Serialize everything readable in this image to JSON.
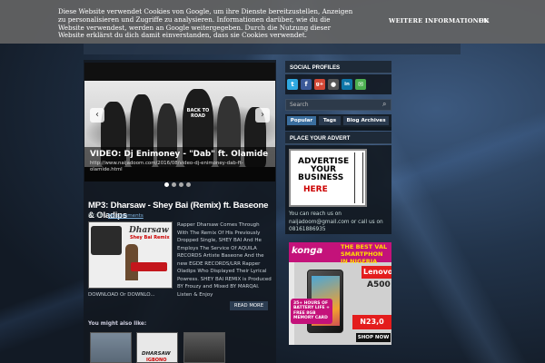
{
  "cookie_bar": {
    "message": "Diese Website verwendet Cookies von Google, um ihre Dienste bereitzustellen, Anzeigen zu personalisieren und Zugriffe zu analysieren. Informationen darüber, wie du die Website verwendest, werden an Google weitergegeben. Durch die Nutzung dieser Website erklärst du dich damit einverstanden, dass sie Cookies verwendet.",
    "more_info_label": "WEITERE INFORMATIONEN",
    "ok_label": "OK"
  },
  "slider": {
    "title": "VIDEO: Dj Enimoney - \"Dab\" ft. Olamide",
    "url": "http://www.naijadoom.com/2016/08/video-dj-enimoney-dab-ft-olamide.html",
    "prev_icon": "chevron-left-icon",
    "next_icon": "chevron-right-icon",
    "shirt_text": "BACK TO ROAD",
    "dots_count": 4,
    "active_dot": 1
  },
  "post": {
    "title": "MP3: Dharsaw - Shey Bai (Remix) ft. Baseone & Oladips",
    "time": "07:18",
    "comments": "No comments",
    "thumb_title": "Dharsaw",
    "thumb_subtitle": "Shey Bai Remix",
    "excerpt": "Rapper Dharsaw Comes Through With The Remix Of His Previously Dropped Single, SHEY BAI And He Employs The Service Of AQUILA RECORDS Artiste Baseone And the new EGDE RECORDS/LRR Rapper Oladips Who Displayed Their Lyrical Powress. SHEY BAI REMIX is Produced BY Frouzy and Mixed BY MARQAI. Listen & Enjoy",
    "excerpt_end": "DOWNLOAD Or DOWNLO...",
    "read_more": "READ MORE"
  },
  "related": {
    "title": "You might also like:",
    "items": [
      {
        "label": ""
      },
      {
        "label": "DHARSAW",
        "sub": "IGBONO"
      },
      {
        "label": ""
      }
    ]
  },
  "sidebar": {
    "social_title": "SOCIAL PROFILES",
    "social_icons": [
      {
        "name": "twitter-icon",
        "glyph": "t",
        "color": "#2fa8e0"
      },
      {
        "name": "facebook-icon",
        "glyph": "f",
        "color": "#3b5998"
      },
      {
        "name": "google-plus-icon",
        "glyph": "g+",
        "color": "#d34836"
      },
      {
        "name": "rss-icon",
        "glyph": "●",
        "color": "#555555"
      },
      {
        "name": "linkedin-icon",
        "glyph": "in",
        "color": "#0e76a8"
      },
      {
        "name": "email-icon",
        "glyph": "✉",
        "color": "#4caf50"
      }
    ],
    "search_placeholder": "Search",
    "tabs": [
      "Popular",
      "Tags",
      "Blog Archives"
    ],
    "active_tab": 0,
    "advert_title": "PLACE YOUR ADVERT",
    "advert_banner_line1": "ADVERTISE",
    "advert_banner_line2": "YOUR",
    "advert_banner_line3": "BUSINESS",
    "advert_banner_here": "HERE",
    "advert_note": "You can reach us on naijadoom@gmail.com or call us on 08161886935",
    "konga": {
      "logo": "konga",
      "headline": "THE BEST VAL SMARTPHON IN NIGERIA",
      "brand": "Lenovo",
      "model": "A500",
      "badge": "35+ HOURS OF BATTERY LIFE + FREE 8GB MEMORY CARD",
      "price": "N23,0",
      "cta": "SHOP NOW"
    }
  },
  "colors": {
    "accent": "#3a6e9e",
    "konga_brand": "#c4127a",
    "lenovo_red": "#e41d1d"
  }
}
